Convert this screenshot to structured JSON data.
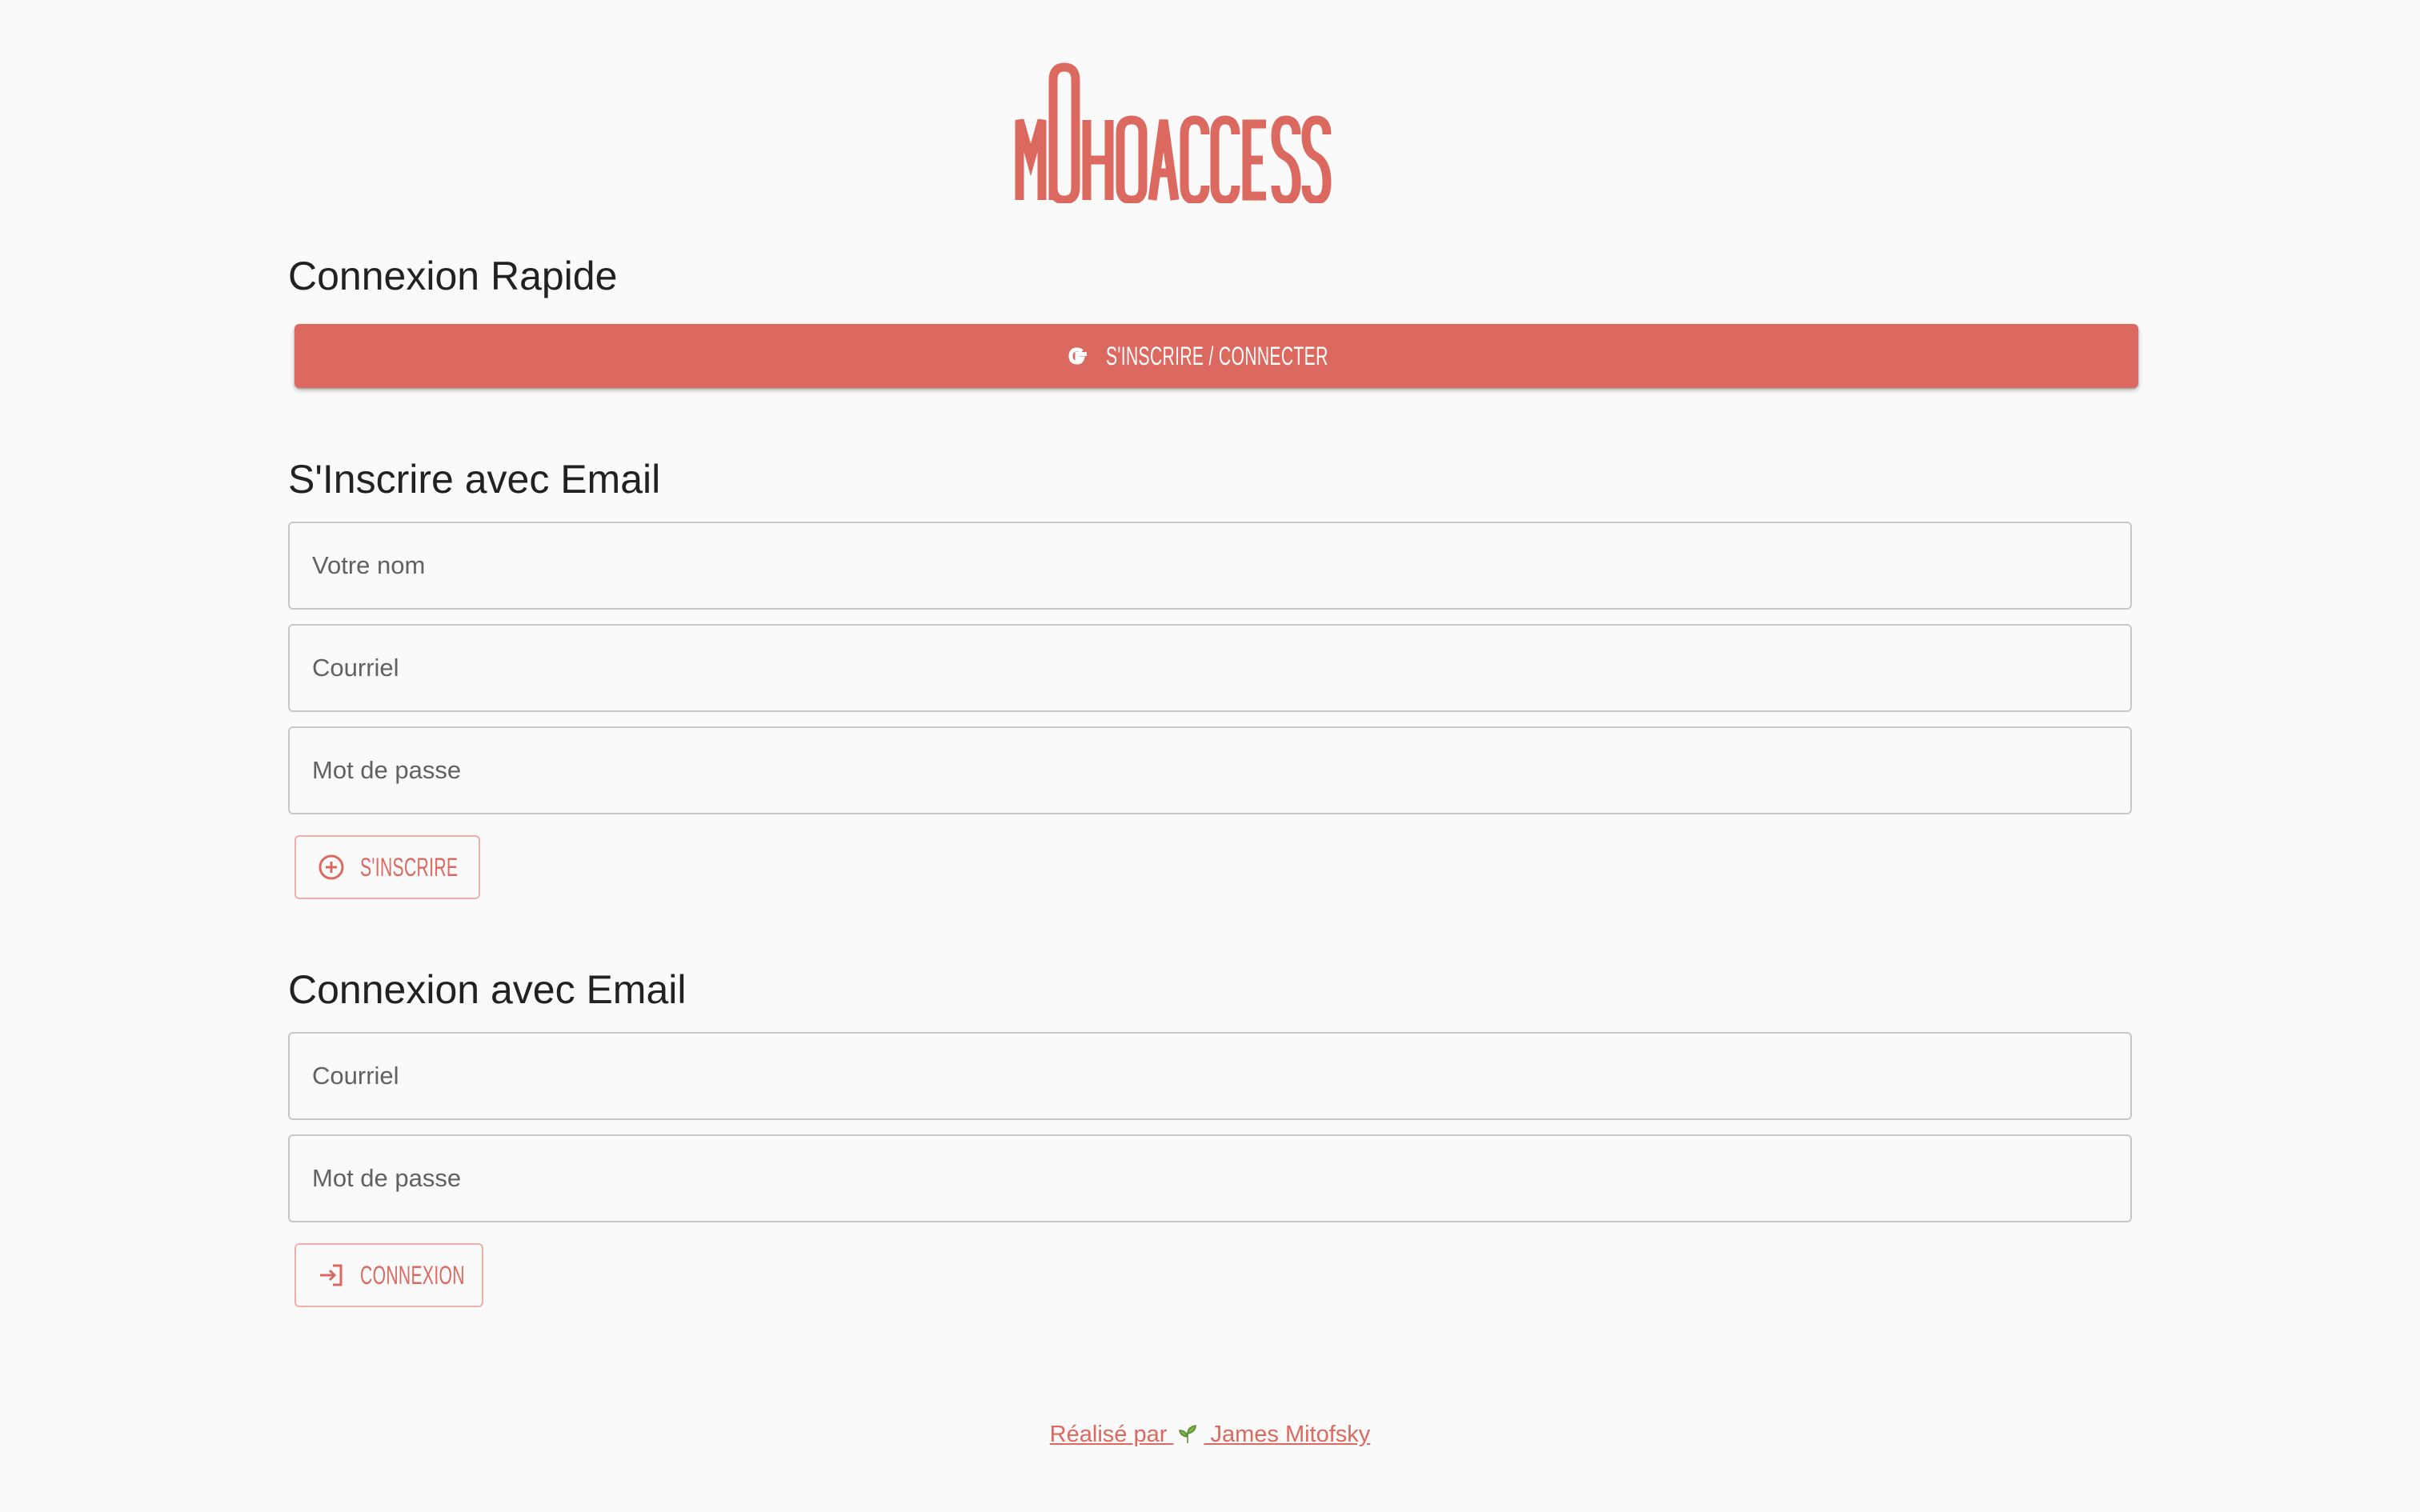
{
  "brand": {
    "logo_text": "MOHOACCESS",
    "accent_color": "#dc695f"
  },
  "quick_login": {
    "heading": "Connexion Rapide",
    "google_button_label": "S'INSCRIRE / CONNECTER",
    "google_icon": "google-icon"
  },
  "signup": {
    "heading": "S'Inscrire avec Email",
    "name_placeholder": "Votre nom",
    "email_placeholder": "Courriel",
    "password_placeholder": "Mot de passe",
    "button_label": "S'INSCRIRE",
    "button_icon": "plus-circle-icon"
  },
  "login": {
    "heading": "Connexion avec Email",
    "email_placeholder": "Courriel",
    "password_placeholder": "Mot de passe",
    "button_label": "CONNEXION",
    "button_icon": "login-icon"
  },
  "footer": {
    "prefix": "Réalisé par",
    "author": "James Mitofsky",
    "icon": "sprout-icon"
  }
}
